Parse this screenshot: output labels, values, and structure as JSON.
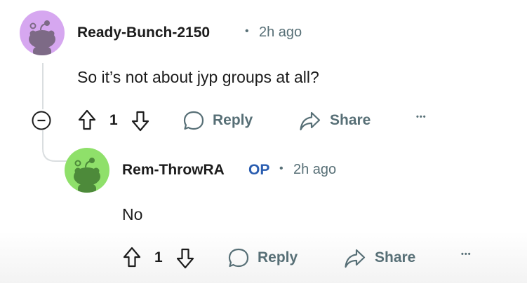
{
  "comments": [
    {
      "username": "Ready-Bunch-2150",
      "separator": "•",
      "time": "2h ago",
      "body": "So it’s not about jyp groups at all?",
      "score": "1",
      "reply_label": "Reply",
      "share_label": "Share",
      "more_label": "•••",
      "avatar_color": "#d6a7f0"
    },
    {
      "username": "Rem-ThrowRA",
      "badge": "OP",
      "separator": "•",
      "time": "2h ago",
      "body": "No",
      "score": "1",
      "reply_label": "Reply",
      "share_label": "Share",
      "more_label": "•••",
      "avatar_color": "#8fe06a"
    }
  ],
  "collapse_symbol": "−",
  "colors": {
    "text": "#1c1c1c",
    "meta": "#576f76",
    "op": "#2a5db0",
    "thread_line": "#dadee0"
  }
}
